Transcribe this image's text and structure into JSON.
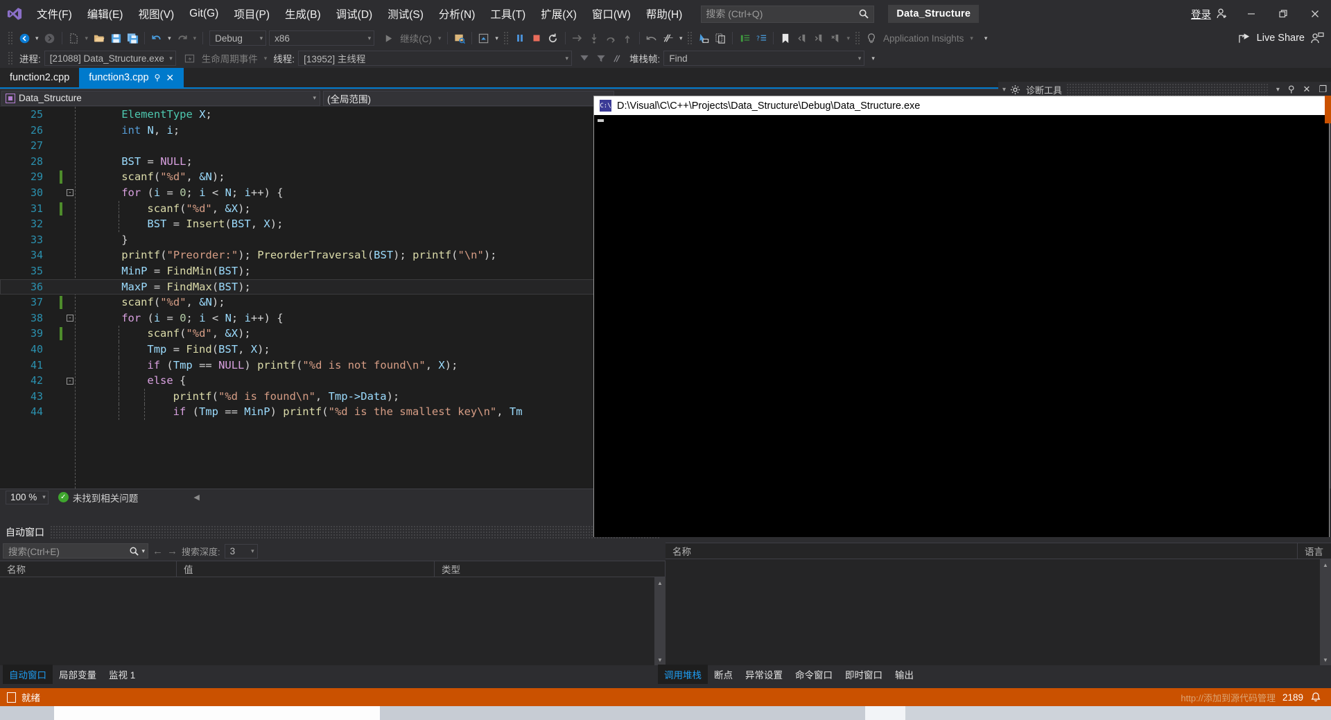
{
  "app": {
    "project_chip": "Data_Structure",
    "sign_in": "登录"
  },
  "menu": {
    "items": [
      {
        "label": "文件(F)"
      },
      {
        "label": "编辑(E)"
      },
      {
        "label": "视图(V)"
      },
      {
        "label": "Git(G)"
      },
      {
        "label": "项目(P)"
      },
      {
        "label": "生成(B)"
      },
      {
        "label": "调试(D)"
      },
      {
        "label": "测试(S)"
      },
      {
        "label": "分析(N)"
      },
      {
        "label": "工具(T)"
      },
      {
        "label": "扩展(X)"
      },
      {
        "label": "窗口(W)"
      },
      {
        "label": "帮助(H)"
      }
    ]
  },
  "search": {
    "placeholder": "搜索 (Ctrl+Q)"
  },
  "live_share": {
    "label": "Live Share"
  },
  "toolbar": {
    "config": "Debug",
    "platform": "x86",
    "continue_label": "继续(C)",
    "app_insights": "Application Insights"
  },
  "debugbar": {
    "process_label": "进程:",
    "process_value": "[21088] Data_Structure.exe",
    "lifecycle_label": "生命周期事件",
    "thread_label": "线程:",
    "thread_value": "[13952] 主线程",
    "stackframe_label": "堆栈帧:",
    "stackframe_value": "Find"
  },
  "tabs": [
    {
      "label": "function2.cpp",
      "active": false
    },
    {
      "label": "function3.cpp",
      "active": true
    }
  ],
  "navbar": {
    "project": "Data_Structure",
    "scope": "(全局范围)"
  },
  "editor": {
    "zoom": "100 %",
    "issues": "未找到相关问题",
    "lines": [
      {
        "n": 25,
        "indent": 1,
        "bp": false,
        "change": false,
        "fold": "",
        "tokens": [
          {
            "t": "ElementType",
            "c": "c-type"
          },
          {
            "t": " ",
            "c": "c-op"
          },
          {
            "t": "X",
            "c": "c-var"
          },
          {
            "t": ";",
            "c": "c-op"
          }
        ]
      },
      {
        "n": 26,
        "indent": 1,
        "bp": false,
        "change": false,
        "fold": "",
        "tokens": [
          {
            "t": "int",
            "c": "c-int"
          },
          {
            "t": " ",
            "c": "c-op"
          },
          {
            "t": "N",
            "c": "c-var"
          },
          {
            "t": ", ",
            "c": "c-op"
          },
          {
            "t": "i",
            "c": "c-var"
          },
          {
            "t": ";",
            "c": "c-op"
          }
        ]
      },
      {
        "n": 27,
        "indent": 1,
        "bp": false,
        "change": false,
        "fold": "",
        "tokens": []
      },
      {
        "n": 28,
        "indent": 1,
        "bp": false,
        "change": false,
        "fold": "",
        "tokens": [
          {
            "t": "BST",
            "c": "c-var"
          },
          {
            "t": " = ",
            "c": "c-op"
          },
          {
            "t": "NULL",
            "c": "c-mac"
          },
          {
            "t": ";",
            "c": "c-op"
          }
        ]
      },
      {
        "n": 29,
        "indent": 1,
        "bp": false,
        "change": true,
        "fold": "",
        "tokens": [
          {
            "t": "scanf",
            "c": "c-fn"
          },
          {
            "t": "(",
            "c": "c-op"
          },
          {
            "t": "\"%d\"",
            "c": "c-str"
          },
          {
            "t": ", ",
            "c": "c-op"
          },
          {
            "t": "&N",
            "c": "c-var"
          },
          {
            "t": ");",
            "c": "c-op"
          }
        ]
      },
      {
        "n": 30,
        "indent": 1,
        "bp": false,
        "change": false,
        "fold": "-",
        "tokens": [
          {
            "t": "for",
            "c": "c-kw"
          },
          {
            "t": " (",
            "c": "c-op"
          },
          {
            "t": "i",
            "c": "c-var"
          },
          {
            "t": " = ",
            "c": "c-op"
          },
          {
            "t": "0",
            "c": "c-num"
          },
          {
            "t": "; ",
            "c": "c-op"
          },
          {
            "t": "i",
            "c": "c-var"
          },
          {
            "t": " < ",
            "c": "c-op"
          },
          {
            "t": "N",
            "c": "c-var"
          },
          {
            "t": "; ",
            "c": "c-op"
          },
          {
            "t": "i",
            "c": "c-var"
          },
          {
            "t": "++) {",
            "c": "c-op"
          }
        ]
      },
      {
        "n": 31,
        "indent": 2,
        "bp": false,
        "change": true,
        "fold": "",
        "tokens": [
          {
            "t": "scanf",
            "c": "c-fn"
          },
          {
            "t": "(",
            "c": "c-op"
          },
          {
            "t": "\"%d\"",
            "c": "c-str"
          },
          {
            "t": ", ",
            "c": "c-op"
          },
          {
            "t": "&X",
            "c": "c-var"
          },
          {
            "t": ");",
            "c": "c-op"
          }
        ]
      },
      {
        "n": 32,
        "indent": 2,
        "bp": false,
        "change": false,
        "fold": "",
        "tokens": [
          {
            "t": "BST",
            "c": "c-var"
          },
          {
            "t": " = ",
            "c": "c-op"
          },
          {
            "t": "Insert",
            "c": "c-fn"
          },
          {
            "t": "(",
            "c": "c-op"
          },
          {
            "t": "BST",
            "c": "c-var"
          },
          {
            "t": ", ",
            "c": "c-op"
          },
          {
            "t": "X",
            "c": "c-var"
          },
          {
            "t": ");",
            "c": "c-op"
          }
        ]
      },
      {
        "n": 33,
        "indent": 1,
        "bp": false,
        "change": false,
        "fold": "",
        "tokens": [
          {
            "t": "}",
            "c": "c-op"
          }
        ]
      },
      {
        "n": 34,
        "indent": 1,
        "bp": false,
        "change": false,
        "fold": "",
        "tokens": [
          {
            "t": "printf",
            "c": "c-fn"
          },
          {
            "t": "(",
            "c": "c-op"
          },
          {
            "t": "\"Preorder:\"",
            "c": "c-str"
          },
          {
            "t": "); ",
            "c": "c-op"
          },
          {
            "t": "PreorderTraversal",
            "c": "c-fn"
          },
          {
            "t": "(",
            "c": "c-op"
          },
          {
            "t": "BST",
            "c": "c-var"
          },
          {
            "t": "); ",
            "c": "c-op"
          },
          {
            "t": "printf",
            "c": "c-fn"
          },
          {
            "t": "(",
            "c": "c-op"
          },
          {
            "t": "\"\\n\"",
            "c": "c-str"
          },
          {
            "t": ");",
            "c": "c-op"
          }
        ]
      },
      {
        "n": 35,
        "indent": 1,
        "bp": false,
        "change": false,
        "fold": "",
        "tokens": [
          {
            "t": "MinP",
            "c": "c-var"
          },
          {
            "t": " = ",
            "c": "c-op"
          },
          {
            "t": "FindMin",
            "c": "c-fn"
          },
          {
            "t": "(",
            "c": "c-op"
          },
          {
            "t": "BST",
            "c": "c-var"
          },
          {
            "t": ");",
            "c": "c-op"
          }
        ]
      },
      {
        "n": 36,
        "indent": 1,
        "bp": false,
        "change": false,
        "fold": "",
        "current": true,
        "tokens": [
          {
            "t": "MaxP",
            "c": "c-var"
          },
          {
            "t": " = ",
            "c": "c-op"
          },
          {
            "t": "FindMax",
            "c": "c-fn"
          },
          {
            "t": "(",
            "c": "c-op"
          },
          {
            "t": "BST",
            "c": "c-var"
          },
          {
            "t": ");",
            "c": "c-op"
          }
        ]
      },
      {
        "n": 37,
        "indent": 1,
        "bp": false,
        "change": true,
        "fold": "",
        "tokens": [
          {
            "t": "scanf",
            "c": "c-fn"
          },
          {
            "t": "(",
            "c": "c-op"
          },
          {
            "t": "\"%d\"",
            "c": "c-str"
          },
          {
            "t": ", ",
            "c": "c-op"
          },
          {
            "t": "&N",
            "c": "c-var"
          },
          {
            "t": ");",
            "c": "c-op"
          }
        ]
      },
      {
        "n": 38,
        "indent": 1,
        "bp": false,
        "change": false,
        "fold": "-",
        "tokens": [
          {
            "t": "for",
            "c": "c-kw"
          },
          {
            "t": " (",
            "c": "c-op"
          },
          {
            "t": "i",
            "c": "c-var"
          },
          {
            "t": " = ",
            "c": "c-op"
          },
          {
            "t": "0",
            "c": "c-num"
          },
          {
            "t": "; ",
            "c": "c-op"
          },
          {
            "t": "i",
            "c": "c-var"
          },
          {
            "t": " < ",
            "c": "c-op"
          },
          {
            "t": "N",
            "c": "c-var"
          },
          {
            "t": "; ",
            "c": "c-op"
          },
          {
            "t": "i",
            "c": "c-var"
          },
          {
            "t": "++) {",
            "c": "c-op"
          }
        ]
      },
      {
        "n": 39,
        "indent": 2,
        "bp": false,
        "change": true,
        "fold": "",
        "tokens": [
          {
            "t": "scanf",
            "c": "c-fn"
          },
          {
            "t": "(",
            "c": "c-op"
          },
          {
            "t": "\"%d\"",
            "c": "c-str"
          },
          {
            "t": ", ",
            "c": "c-op"
          },
          {
            "t": "&X",
            "c": "c-var"
          },
          {
            "t": ");",
            "c": "c-op"
          }
        ]
      },
      {
        "n": 40,
        "indent": 2,
        "bp": false,
        "change": false,
        "fold": "",
        "tokens": [
          {
            "t": "Tmp",
            "c": "c-var"
          },
          {
            "t": " = ",
            "c": "c-op"
          },
          {
            "t": "Find",
            "c": "c-fn"
          },
          {
            "t": "(",
            "c": "c-op"
          },
          {
            "t": "BST",
            "c": "c-var"
          },
          {
            "t": ", ",
            "c": "c-op"
          },
          {
            "t": "X",
            "c": "c-var"
          },
          {
            "t": ");",
            "c": "c-op"
          }
        ]
      },
      {
        "n": 41,
        "indent": 2,
        "bp": false,
        "change": false,
        "fold": "",
        "tokens": [
          {
            "t": "if",
            "c": "c-kw"
          },
          {
            "t": " (",
            "c": "c-op"
          },
          {
            "t": "Tmp",
            "c": "c-var"
          },
          {
            "t": " == ",
            "c": "c-op"
          },
          {
            "t": "NULL",
            "c": "c-mac"
          },
          {
            "t": ") ",
            "c": "c-op"
          },
          {
            "t": "printf",
            "c": "c-fn"
          },
          {
            "t": "(",
            "c": "c-op"
          },
          {
            "t": "\"%d is not found\\n\"",
            "c": "c-str"
          },
          {
            "t": ", ",
            "c": "c-op"
          },
          {
            "t": "X",
            "c": "c-var"
          },
          {
            "t": ");",
            "c": "c-op"
          }
        ]
      },
      {
        "n": 42,
        "indent": 2,
        "bp": false,
        "change": false,
        "fold": "-",
        "tokens": [
          {
            "t": "else",
            "c": "c-kw"
          },
          {
            "t": " {",
            "c": "c-op"
          }
        ]
      },
      {
        "n": 43,
        "indent": 3,
        "bp": false,
        "change": false,
        "fold": "",
        "tokens": [
          {
            "t": "printf",
            "c": "c-fn"
          },
          {
            "t": "(",
            "c": "c-op"
          },
          {
            "t": "\"%d is found\\n\"",
            "c": "c-str"
          },
          {
            "t": ", ",
            "c": "c-op"
          },
          {
            "t": "Tmp->Data",
            "c": "c-var"
          },
          {
            "t": ");",
            "c": "c-op"
          }
        ]
      },
      {
        "n": 44,
        "indent": 3,
        "bp": false,
        "change": false,
        "fold": "",
        "tokens": [
          {
            "t": "if",
            "c": "c-kw"
          },
          {
            "t": " (",
            "c": "c-op"
          },
          {
            "t": "Tmp",
            "c": "c-var"
          },
          {
            "t": " == ",
            "c": "c-op"
          },
          {
            "t": "MinP",
            "c": "c-var"
          },
          {
            "t": ") ",
            "c": "c-op"
          },
          {
            "t": "printf",
            "c": "c-fn"
          },
          {
            "t": "(",
            "c": "c-op"
          },
          {
            "t": "\"%d is the smallest key\\n\"",
            "c": "c-str"
          },
          {
            "t": ", ",
            "c": "c-op"
          },
          {
            "t": "Tm",
            "c": "c-var"
          }
        ]
      }
    ]
  },
  "autos_panel": {
    "title": "自动窗口",
    "search_placeholder": "搜索(Ctrl+E)",
    "depth_label": "搜索深度:",
    "depth_value": "3",
    "columns": [
      "名称",
      "值",
      "类型"
    ],
    "rows": []
  },
  "callstack_panel": {
    "columns": [
      "名称",
      "语言"
    ],
    "rows": []
  },
  "bottom_left_tabs": [
    {
      "label": "自动窗口",
      "active": true
    },
    {
      "label": "局部变量",
      "active": false
    },
    {
      "label": "监视 1",
      "active": false
    }
  ],
  "bottom_right_tabs": [
    {
      "label": "调用堆栈",
      "active": true
    },
    {
      "label": "断点",
      "active": false
    },
    {
      "label": "异常设置",
      "active": false
    },
    {
      "label": "命令窗口",
      "active": false
    },
    {
      "label": "即时窗口",
      "active": false
    },
    {
      "label": "输出",
      "active": false
    }
  ],
  "diagnostics": {
    "title": "诊断工具"
  },
  "console": {
    "title": "D:\\Visual\\C\\C++\\Projects\\Data_Structure\\Debug\\Data_Structure.exe",
    "output": ""
  },
  "statusbar": {
    "ready": "就绪",
    "watermark": "http://添加到源代码管理",
    "counter": "2189"
  },
  "colors": {
    "accent": "#007acc",
    "status_debug": "#ca5100",
    "editor_bg": "#1e1e1e",
    "chrome_bg": "#2d2d30",
    "panel_bg": "#252526"
  }
}
